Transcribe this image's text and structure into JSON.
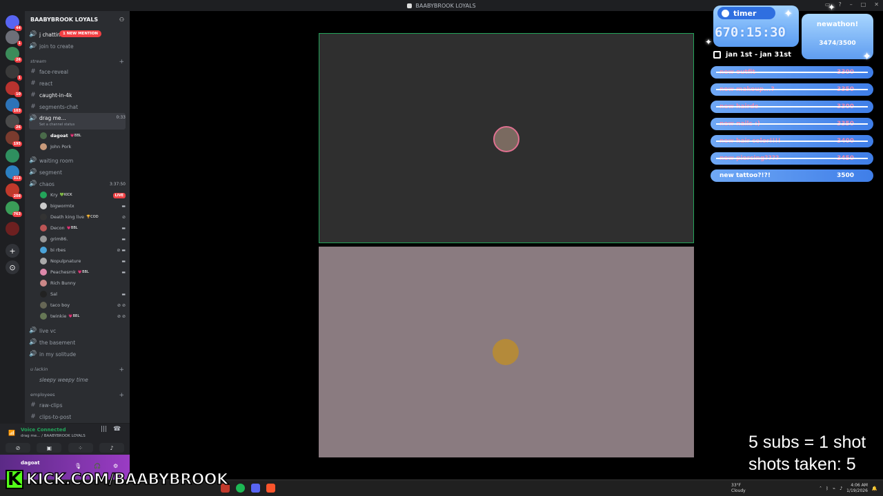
{
  "window": {
    "title": "BAABYBROOK LOYALS"
  },
  "servers": {
    "badges": [
      "44",
      "1",
      "26",
      "1",
      "10",
      "103",
      "26",
      "195",
      "313",
      "208",
      "763"
    ],
    "colors": [
      "#5865f2",
      "#6d6f78",
      "#3b8c5a",
      "#3a3a3a",
      "#b8332f",
      "#2d73b8",
      "#4a4a4a",
      "#7a3b2e",
      "#2f8f5f",
      "#2c7fc0",
      "#c0392b",
      "#3a9d58"
    ]
  },
  "sidebar": {
    "server_name": "BAABYBROOK LOYALS",
    "mention_badge": "1 NEW MENTION",
    "top_channels": [
      "j chattin",
      "join to create"
    ],
    "categories": {
      "stream": "stream",
      "ulackin": "u lackin",
      "employees": "employees"
    },
    "stream_channels": [
      "face-reveal",
      "react",
      "caught-in-4k",
      "segments-chat"
    ],
    "active_vc": {
      "name": "drag me...",
      "time": "0:33",
      "status": "Set a channel status"
    },
    "active_vc_users": [
      {
        "name": "dagoat",
        "tag": "BBL"
      },
      {
        "name": "John Pork",
        "tag": ""
      }
    ],
    "more_channels": [
      "waiting room",
      "segment"
    ],
    "chaos": {
      "name": "chaos",
      "time": "3:37:50"
    },
    "chaos_users": [
      {
        "name": "Kry",
        "tag": "KICK",
        "live": "LIVE"
      },
      {
        "name": "bigwormtx",
        "tag": ""
      },
      {
        "name": "Death king live",
        "tag": "COD"
      },
      {
        "name": "Decon",
        "tag": "BBL"
      },
      {
        "name": "grim86.",
        "tag": ""
      },
      {
        "name": "bi rbes",
        "tag": ""
      },
      {
        "name": "Nopulpnature",
        "tag": ""
      },
      {
        "name": "Peachesmk",
        "tag": "BBL"
      },
      {
        "name": "Rich Bunny",
        "tag": ""
      },
      {
        "name": "Sal",
        "tag": ""
      },
      {
        "name": "taco boy",
        "tag": ""
      },
      {
        "name": "twinkie",
        "tag": "BBL"
      }
    ],
    "lower_channels": [
      "live vc",
      "the basement",
      "in my solitude"
    ],
    "ulackin_channels": [
      "sleepy weepy time"
    ],
    "employee_channels": [
      "raw-clips",
      "clips-to-post"
    ]
  },
  "voice": {
    "title": "Voice Connected",
    "subtitle": "drag me... / BAABYBROOK LOYALS"
  },
  "user_panel": {
    "name": "dagoat"
  },
  "kick": {
    "url": "KICK.COM/BAABYBROOK",
    "letter": "K",
    "brand_color": "#53fc18"
  },
  "overlay": {
    "timer_label": "timer",
    "timer_value": "670:15:30",
    "newathon_label": "newathon!",
    "newathon_count": "3474/3500",
    "dates": "jan 1st - jan 31st",
    "goals": [
      {
        "label": "new outfit",
        "value": "3300",
        "done": true
      },
      {
        "label": "new makeup...?",
        "value": "3350",
        "done": true
      },
      {
        "label": "new hairdo",
        "value": "3300",
        "done": true
      },
      {
        "label": "new nails :)",
        "value": "3350",
        "done": true
      },
      {
        "label": "new hair color!!!!",
        "value": "3400",
        "done": true
      },
      {
        "label": "new piercing????",
        "value": "3450",
        "done": true
      },
      {
        "label": "new tattoo?!?!",
        "value": "3500",
        "done": false
      }
    ],
    "subs_rule": "5 subs = 1 shot",
    "shots_taken": "shots taken: 5"
  },
  "taskbar": {
    "weather_temp": "33°F",
    "weather_desc": "Cloudy",
    "time": "4:06 AM",
    "date": "1/19/2026"
  }
}
